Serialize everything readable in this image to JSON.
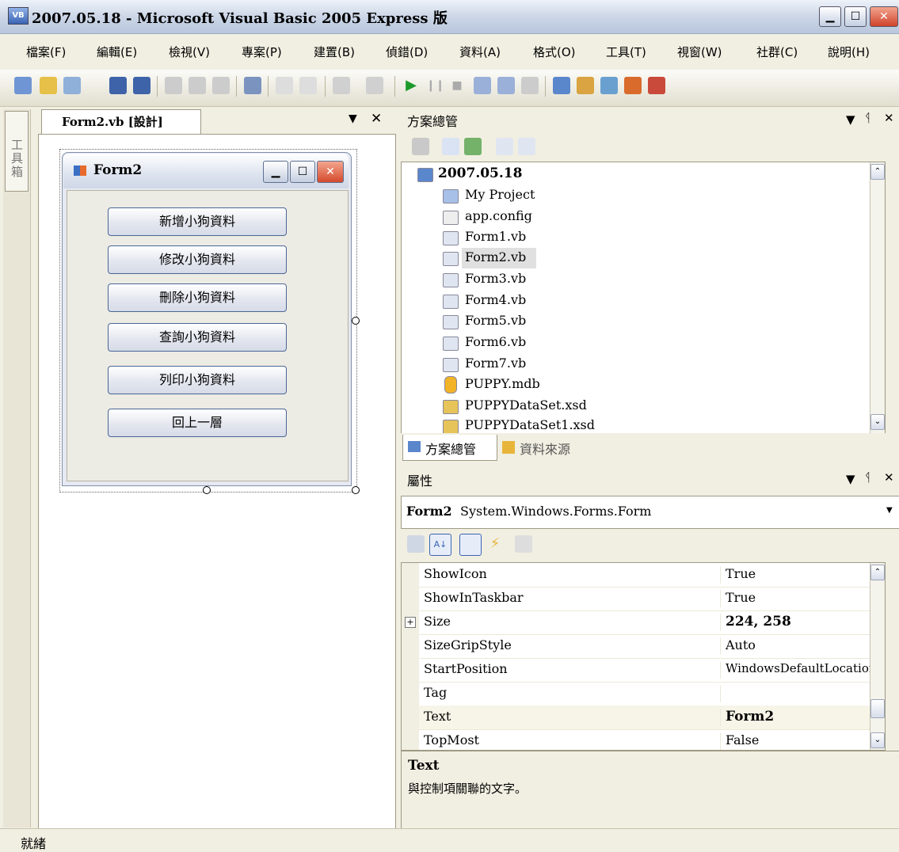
{
  "window": {
    "title": "2007.05.18 - Microsoft Visual Basic 2005 Express 版",
    "icon": "vb-icon"
  },
  "menu": [
    "檔案(F)",
    "編輯(E)",
    "檢視(V)",
    "專案(P)",
    "建置(B)",
    "偵錯(D)",
    "資料(A)",
    "格式(O)",
    "工具(T)",
    "視窗(W)",
    "社群(C)",
    "說明(H)"
  ],
  "toolbox": {
    "label": "工具箱"
  },
  "designer": {
    "tab_label": "Form2.vb [設計]",
    "form_title": "Form2",
    "buttons": [
      "新增小狗資料",
      "修改小狗資料",
      "刪除小狗資料",
      "查詢小狗資料",
      "列印小狗資料",
      "回上一層"
    ]
  },
  "solution_explorer": {
    "title": "方案總管",
    "root": "2007.05.18",
    "items": [
      "My Project",
      "app.config",
      "Form1.vb",
      "Form2.vb",
      "Form3.vb",
      "Form4.vb",
      "Form5.vb",
      "Form6.vb",
      "Form7.vb",
      "PUPPY.mdb",
      "PUPPYDataSet.xsd",
      "PUPPYDataSet1.xsd"
    ],
    "selected": "Form2.vb"
  },
  "bottom_tabs": [
    "方案總管",
    "資料來源"
  ],
  "properties": {
    "title": "屬性",
    "object_name": "Form2",
    "object_type": "System.Windows.Forms.Form",
    "rows": [
      {
        "name": "ShowIcon",
        "value": "True"
      },
      {
        "name": "ShowInTaskbar",
        "value": "True"
      },
      {
        "name": "Size",
        "value": "224, 258"
      },
      {
        "name": "SizeGripStyle",
        "value": "Auto"
      },
      {
        "name": "StartPosition",
        "value": "WindowsDefaultLocation"
      },
      {
        "name": "Tag",
        "value": ""
      },
      {
        "name": "Text",
        "value": "Form2"
      },
      {
        "name": "TopMost",
        "value": "False"
      }
    ],
    "description_title": "Text",
    "description_text": "與控制項關聯的文字。"
  },
  "status": {
    "text": "就緒"
  },
  "colors": {
    "selection": "#e0e0e0",
    "accent": "#3b64b5"
  }
}
